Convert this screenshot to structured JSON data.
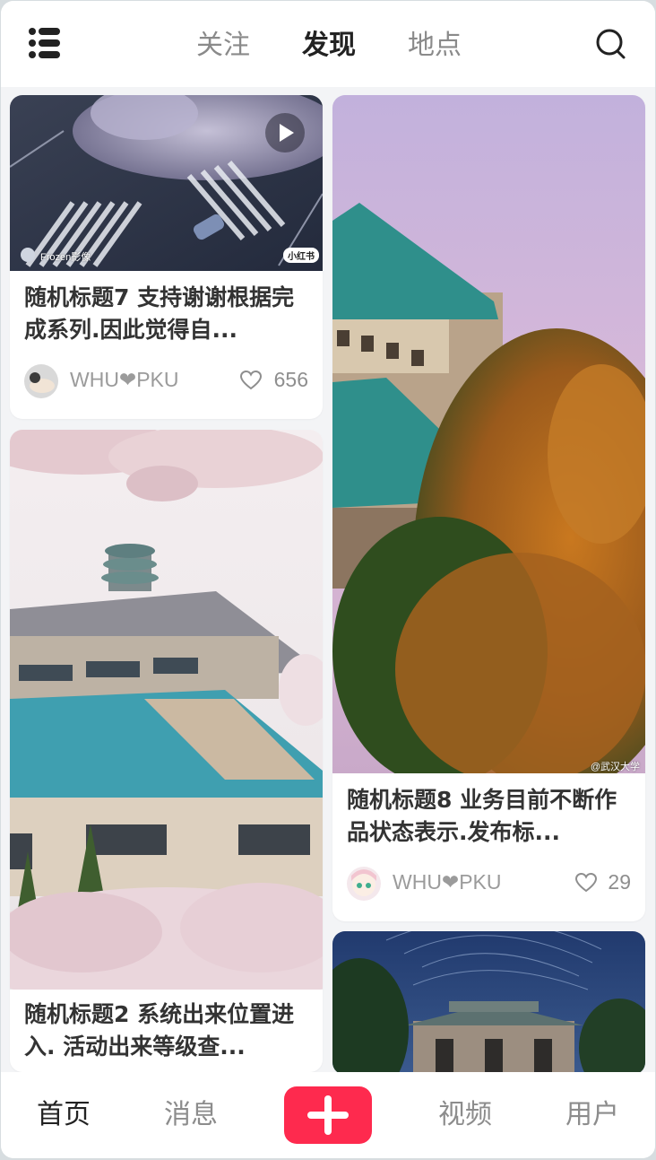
{
  "header": {
    "tabs": [
      {
        "label": "关注",
        "active": false
      },
      {
        "label": "发现",
        "active": true
      },
      {
        "label": "地点",
        "active": false
      }
    ]
  },
  "feed": {
    "cards": [
      {
        "title": "随机标题7 支持谢谢根据完成系列.因此觉得自...",
        "author": "WHU❤PKU",
        "likes": "656",
        "image_author": "Frozen影像",
        "image_badge": "小红书",
        "type": "video"
      },
      {
        "title": "随机标题8 业务目前不断作品状态表示.发布标...",
        "author": "WHU❤PKU",
        "likes": "29",
        "watermark": "@武汉大学"
      },
      {
        "title": "随机标题2 系统出来位置进入. 活动出来等级查...",
        "author": "",
        "likes": ""
      },
      {
        "title": "",
        "author": "",
        "likes": ""
      }
    ]
  },
  "bottom_nav": {
    "items": [
      {
        "label": "首页",
        "active": true
      },
      {
        "label": "消息",
        "active": false
      },
      {
        "label": "视频",
        "active": false
      },
      {
        "label": "用户",
        "active": false
      }
    ],
    "add_color": "#fe2a4e"
  },
  "icons": [
    "menu-icon",
    "search-icon",
    "play-icon",
    "heart-icon",
    "plus-icon"
  ]
}
